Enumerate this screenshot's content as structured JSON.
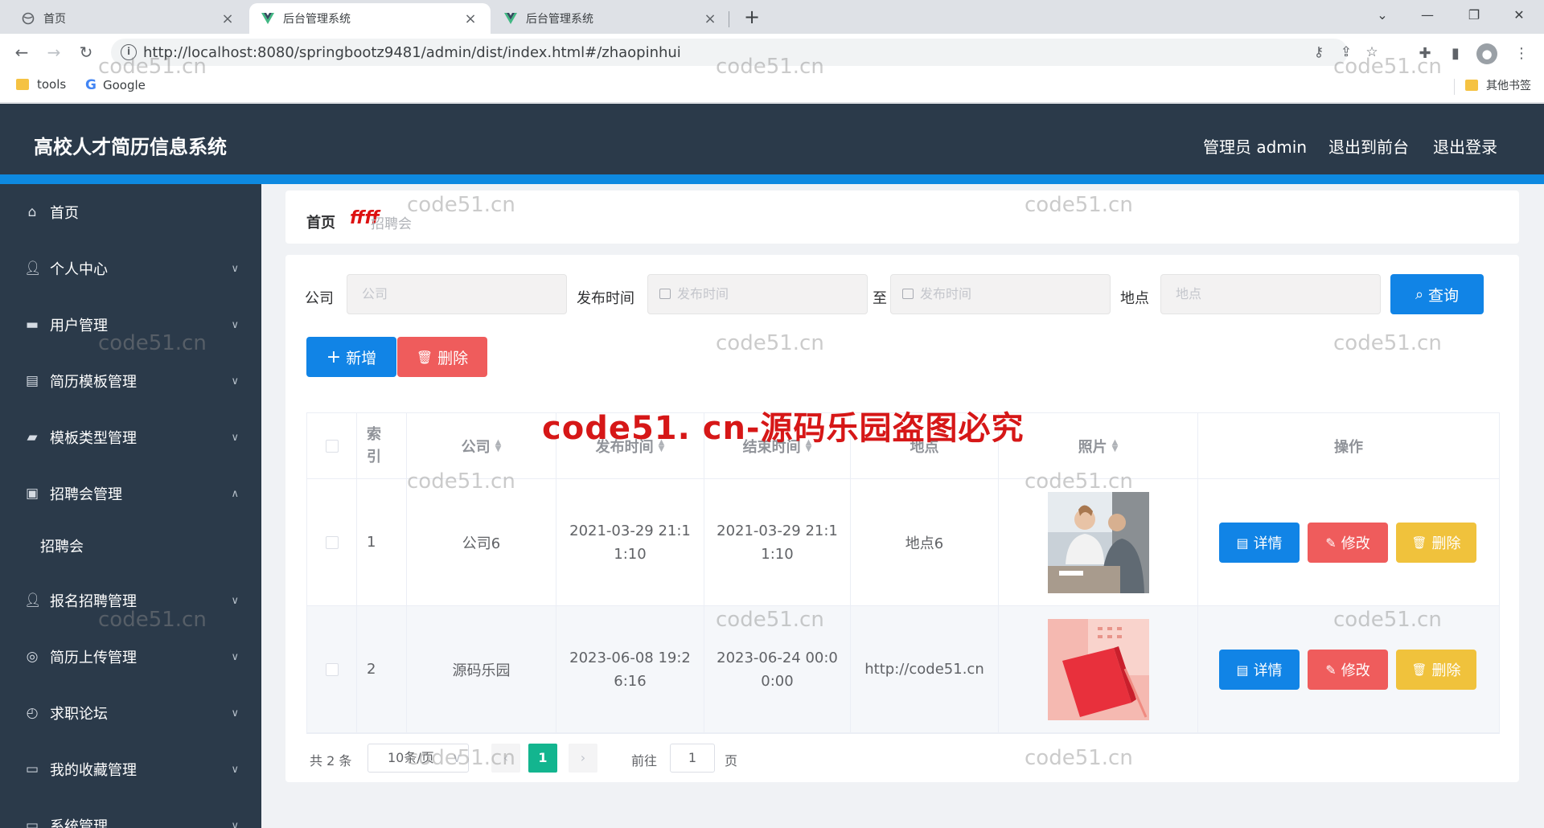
{
  "browser": {
    "tabs": [
      {
        "title": "首页"
      },
      {
        "title": "后台管理系统"
      },
      {
        "title": "后台管理系统"
      }
    ],
    "url": "http://localhost:8080/springbootz9481/admin/dist/index.html#/zhaopinhui",
    "bookmarks": [
      {
        "label": "tools"
      },
      {
        "label": "Google"
      },
      {
        "label": "其他书签"
      }
    ]
  },
  "header": {
    "title": "高校人才简历信息系统",
    "admin": "管理员 admin",
    "to_front": "退出到前台",
    "logout": "退出登录"
  },
  "sidebar": {
    "items": [
      {
        "label": "首页",
        "icon": "home-icon"
      },
      {
        "label": "个人中心",
        "icon": "user-icon"
      },
      {
        "label": "用户管理",
        "icon": "users-icon"
      },
      {
        "label": "简历模板管理",
        "icon": "document-icon"
      },
      {
        "label": "模板类型管理",
        "icon": "template-icon"
      },
      {
        "label": "招聘会管理",
        "icon": "ticket-icon"
      },
      {
        "label": "报名招聘管理",
        "icon": "user-icon"
      },
      {
        "label": "简历上传管理",
        "icon": "compass-icon"
      },
      {
        "label": "求职论坛",
        "icon": "forum-icon"
      },
      {
        "label": "我的收藏管理",
        "icon": "monitor-icon"
      },
      {
        "label": "系统管理",
        "icon": "settings-icon"
      }
    ],
    "subitem": "招聘会"
  },
  "breadcrumb": {
    "home": "首页",
    "separator": "ffff",
    "current": "招聘会"
  },
  "search": {
    "company_label": "公司",
    "company_placeholder": "公司",
    "time_label": "发布时间",
    "time_start_placeholder": "发布时间",
    "to": "至",
    "time_end_placeholder": "发布时间",
    "place_label": "地点",
    "place_placeholder": "地点",
    "query": "查询"
  },
  "actions": {
    "add": "新增",
    "delete": "删除"
  },
  "table": {
    "headers": [
      "索引",
      "公司",
      "发布时间",
      "结束时间",
      "地点",
      "照片",
      "操作"
    ],
    "rows": [
      {
        "index": "1",
        "company": "公司6",
        "publish": "2021-03-29 21:11:10",
        "end": "2021-03-29 21:11:10",
        "place": "地点6"
      },
      {
        "index": "2",
        "company": "源码乐园",
        "publish": "2023-06-08 19:26:16",
        "end": "2023-06-24 00:00:00",
        "place": "http://code51.cn"
      }
    ],
    "row_buttons": {
      "detail": "详情",
      "edit": "修改",
      "delete": "删除"
    }
  },
  "pagination": {
    "total": "共 2 条",
    "page_size": "10条/页",
    "current_page": "1",
    "goto_label": "前往",
    "goto_value": "1",
    "page_suffix": "页"
  },
  "watermark": {
    "small": "code51.cn",
    "big": "code51. cn-源码乐园盗图必究"
  },
  "colors": {
    "header": "#2b3a4a",
    "accent": "#0e89e0",
    "primary": "#1184e6",
    "danger": "#ef5c5c",
    "warning": "#f0c23c",
    "page_active": "#13b58f"
  }
}
